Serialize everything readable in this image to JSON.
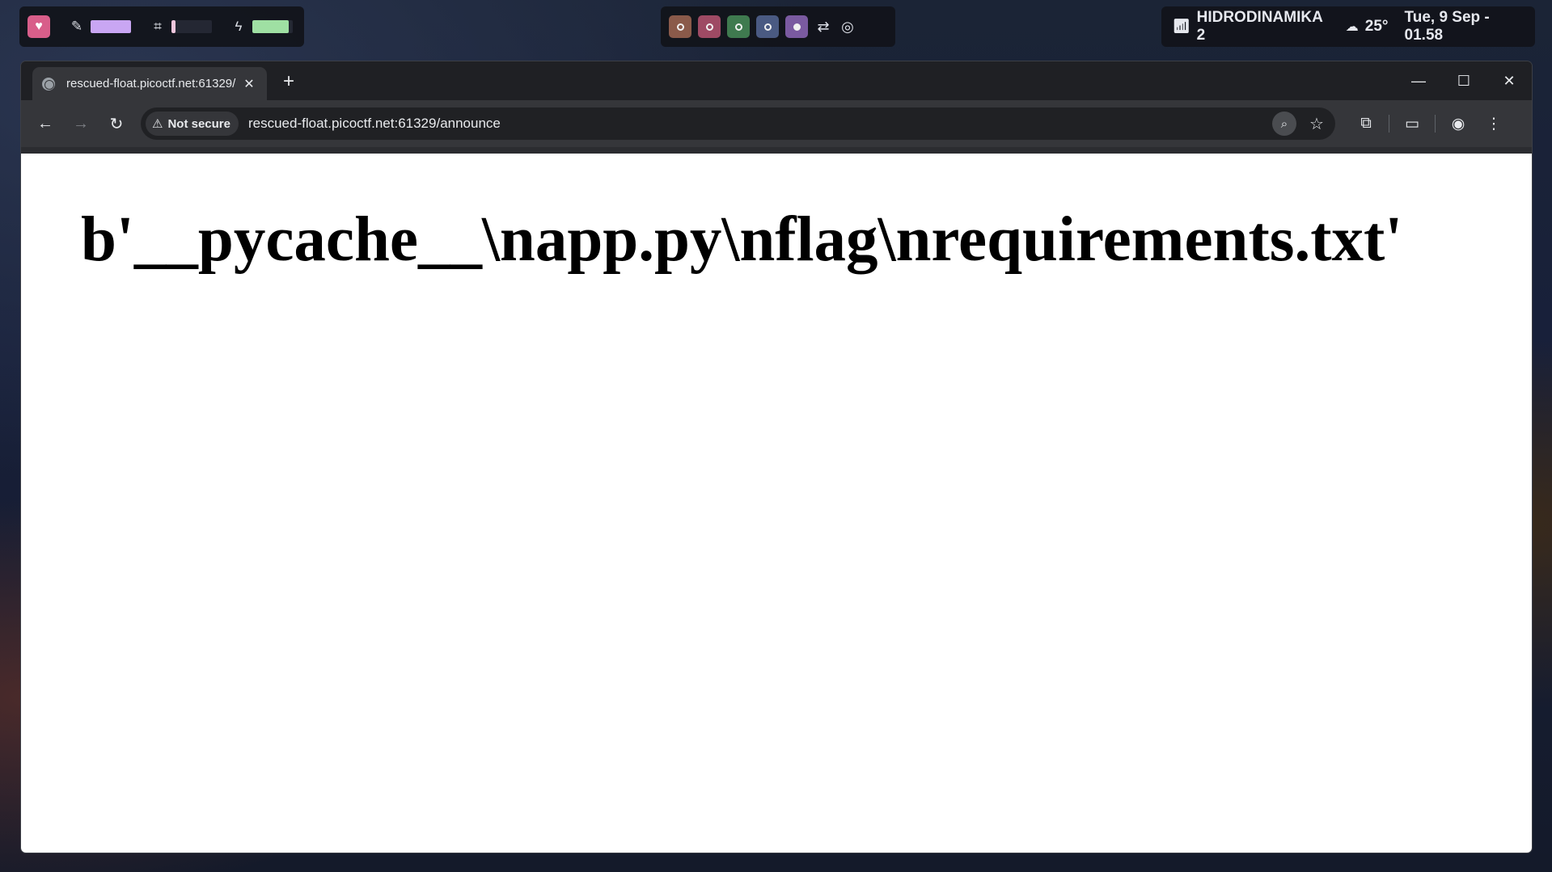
{
  "topbar": {
    "left": {
      "heart_icon": "heart-icon",
      "stats": [
        {
          "icon": "pencil-icon",
          "glyph": "✎",
          "level": 1.0,
          "color": "#c9a6f3"
        },
        {
          "icon": "cpu-icon",
          "glyph": "⌗",
          "level": 0.1,
          "color": "#f2c7de"
        },
        {
          "icon": "lightning-icon",
          "glyph": "ϟ",
          "level": 0.9,
          "color": "#9fe0a3"
        }
      ]
    },
    "workspaces": [
      {
        "color": "#8a5a4a",
        "active": false
      },
      {
        "color": "#9e4a64",
        "active": false
      },
      {
        "color": "#3f7a4f",
        "active": false
      },
      {
        "color": "#4a5a82",
        "active": false
      },
      {
        "color": "#7a5aa0",
        "active": true
      }
    ],
    "right": {
      "wifi_icon": "wifi-icon",
      "network": "HIDRODINAMIKA 2",
      "weather_icon": "cloud-icon",
      "temperature": "25°",
      "datetime": "Tue, 9 Sep - 01.58"
    }
  },
  "browser": {
    "tab": {
      "title": "rescued-float.picoctf.net:61329/"
    },
    "new_tab": "+",
    "security": "Not secure",
    "url": "rescued-float.picoctf.net:61329/announce"
  },
  "page": {
    "heading": "b'__pycache__\\napp.py\\nflag\\nrequirements.txt'"
  }
}
